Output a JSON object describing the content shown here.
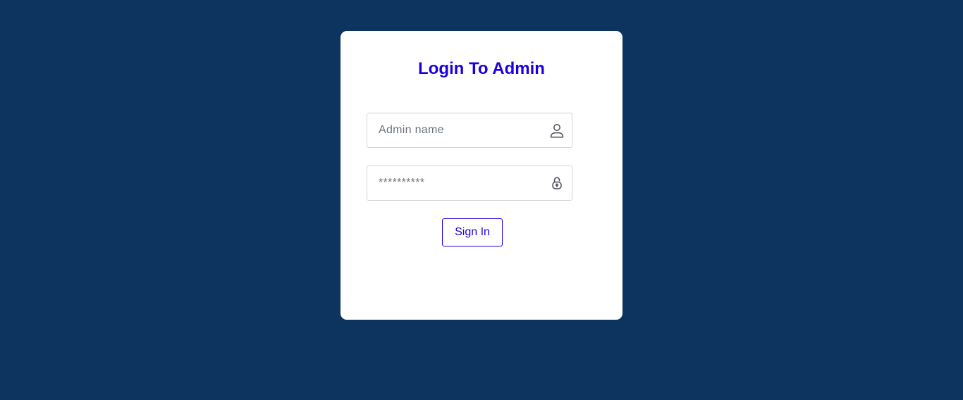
{
  "colors": {
    "background": "#0c345e",
    "card": "#ffffff",
    "accent": "#1d00e0",
    "input_border": "#cfd3d7"
  },
  "login": {
    "title": "Login To Admin",
    "username": {
      "placeholder": "Admin name",
      "value": "",
      "icon": "user-icon"
    },
    "password": {
      "placeholder": "**********",
      "value": "",
      "icon": "lock-icon"
    },
    "submit_label": "Sign In"
  }
}
